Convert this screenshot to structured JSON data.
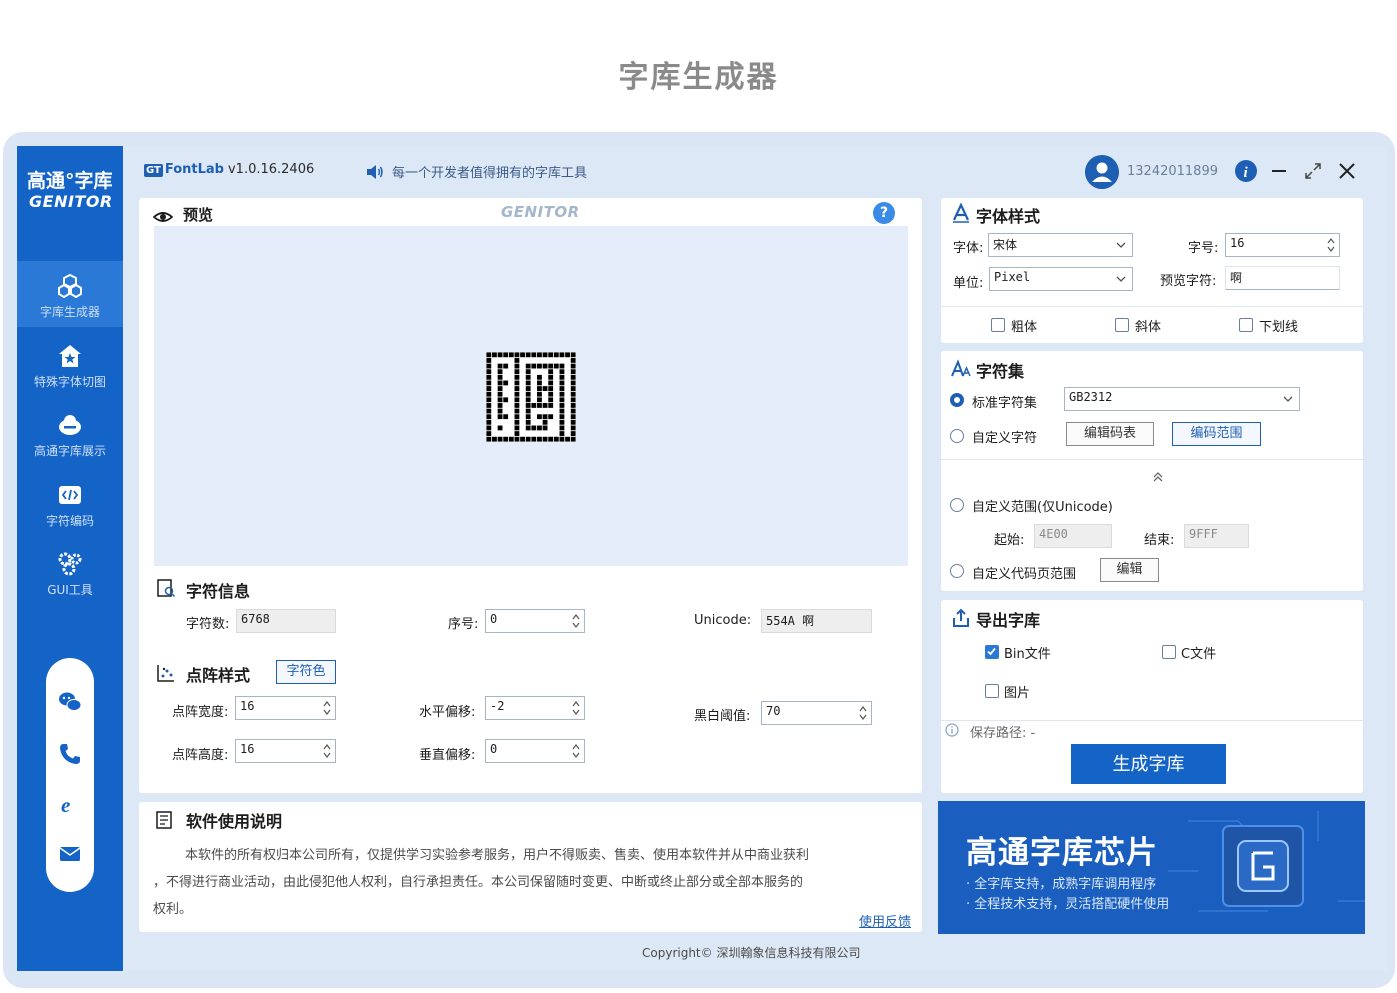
{
  "page": {
    "title": "字库生成器"
  },
  "app": {
    "logo_cn": "高通°字库",
    "logo_en": "GENITOR",
    "version_brand": "FontLab",
    "version": "v1.0.16.2406",
    "slogan": "每一个开发者值得拥有的字库工具",
    "user_phone": "13242011899"
  },
  "sidebar": {
    "items": [
      {
        "label": "字库生成器",
        "icon": "cubes-icon",
        "active": true
      },
      {
        "label": "特殊字体切图",
        "icon": "star-house-icon",
        "active": false
      },
      {
        "label": "高通字库展示",
        "icon": "cloud-icon",
        "active": false
      },
      {
        "label": "字符编码",
        "icon": "code-icon",
        "active": false
      },
      {
        "label": "GUI工具",
        "icon": "gears-icon",
        "active": false
      }
    ],
    "contacts": [
      "wechat-icon",
      "phone-icon",
      "browser-icon",
      "mail-icon"
    ]
  },
  "preview": {
    "title": "预览",
    "watermark": "GENITOR",
    "help_symbol": "?"
  },
  "char_info": {
    "title": "字符信息",
    "count_label": "字符数:",
    "count_value": "6768",
    "index_label": "序号:",
    "index_value": "0",
    "unicode_label": "Unicode:",
    "unicode_value": "554A 啊"
  },
  "dot_style": {
    "title": "点阵样式",
    "color_button": "字符色",
    "width_label": "点阵宽度:",
    "width_value": "16",
    "height_label": "点阵高度:",
    "height_value": "16",
    "h_offset_label": "水平偏移:",
    "h_offset_value": "-2",
    "v_offset_label": "垂直偏移:",
    "v_offset_value": "0",
    "threshold_label": "黑白阈值:",
    "threshold_value": "70"
  },
  "manual": {
    "title": "软件使用说明",
    "text_line1": "本软件的所有权归本公司所有，仅提供学习实验参考服务，用户不得贩卖、售卖、使用本软件并从中商业获利",
    "text_line2": "，不得进行商业活动，由此侵犯他人权利，自行承担责任。本公司保留随时变更、中断或终止部分或全部本服务的",
    "text_line3": "权利。",
    "feedback": "使用反馈"
  },
  "font_style": {
    "title": "字体样式",
    "font_label": "字体:",
    "font_value": "宋体",
    "size_label": "字号:",
    "size_value": "16",
    "unit_label": "单位:",
    "unit_value": "Pixel",
    "preview_char_label": "预览字符:",
    "preview_char_value": "啊",
    "bold": "粗体",
    "italic": "斜体",
    "underline": "下划线"
  },
  "charset": {
    "title": "字符集",
    "standard_label": "标准字符集",
    "standard_value": "GB2312",
    "custom_label": "自定义字符",
    "edit_table": "编辑码表",
    "code_range": "编码范围",
    "custom_range_label": "自定义范围(仅Unicode)",
    "start_label": "起始:",
    "start_value": "4E00",
    "end_label": "结束:",
    "end_value": "9FFF",
    "codepage_label": "自定义代码页范围",
    "edit": "编辑"
  },
  "export": {
    "title": "导出字库",
    "bin": "Bin文件",
    "bin_checked": true,
    "c_file": "C文件",
    "c_checked": false,
    "image": "图片",
    "image_checked": false,
    "save_path": "保存路径: -",
    "generate": "生成字库"
  },
  "banner": {
    "title": "高通字库芯片",
    "line1": "· 全字库支持，成熟字库调用程序",
    "line2": "· 全程技术支持，灵活搭配硬件使用"
  },
  "footer": {
    "copyright": "Copyright© 深圳翰象信息科技有限公司"
  },
  "colors": {
    "brand": "#1463c7",
    "accent": "#1e5fb4",
    "frame": "#dde8f7"
  }
}
